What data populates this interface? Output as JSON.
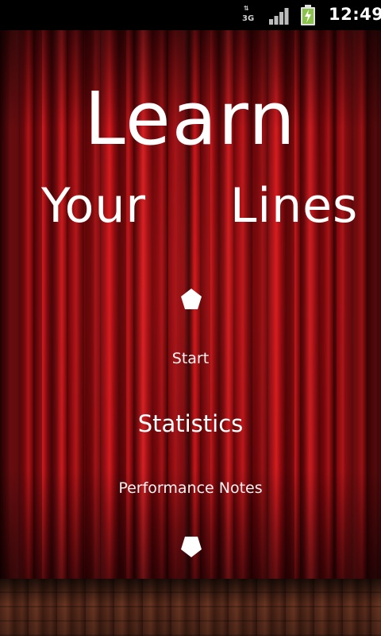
{
  "status_bar": {
    "network_label": "3G",
    "time": "12:49",
    "icons": [
      "data-transfer-icon",
      "signal-strength-icon",
      "battery-charging-icon"
    ],
    "battery_color": "#8bc34a"
  },
  "title": {
    "line1": "Learn",
    "line2_left": "Your",
    "line2_right": "Lines"
  },
  "menu": {
    "items": [
      {
        "label": "Start"
      },
      {
        "label": "Statistics"
      },
      {
        "label": "Performance Notes"
      }
    ],
    "scroll_up_icon": "pentagon-icon",
    "scroll_down_icon": "pentagon-icon"
  },
  "theme": {
    "curtain_color": "#b5121b",
    "floor_color": "#6b3522",
    "text_color": "#ffffff"
  }
}
